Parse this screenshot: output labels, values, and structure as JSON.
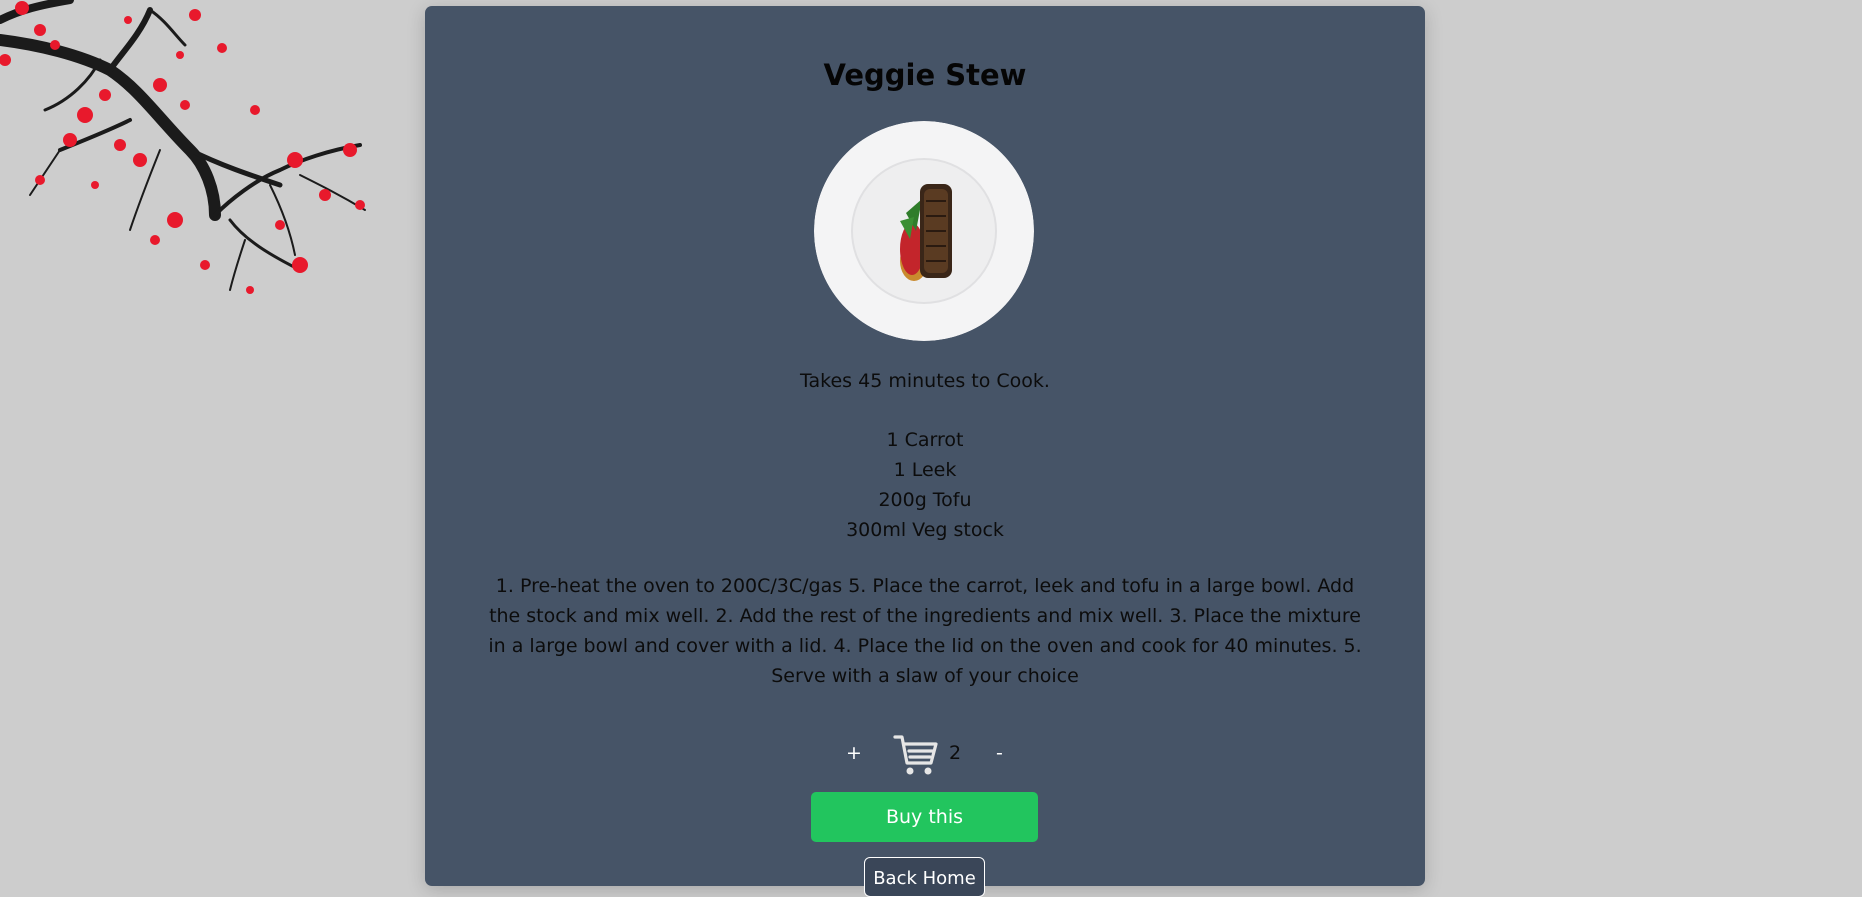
{
  "recipe": {
    "title": "Veggie Stew",
    "time_text": "Takes 45 minutes to Cook.",
    "ingredients": [
      "1 Carrot",
      "1 Leek",
      "200g Tofu",
      "300ml Veg stock"
    ],
    "instructions": "1. Pre-heat the oven to 200C/3C/gas 5. Place the carrot, leek and tofu in a large bowl. Add the stock and mix well. 2. Add the rest of the ingredients and mix well. 3. Place the mixture in a large bowl and cover with a lid. 4. Place the lid on the oven and cook for 40 minutes. 5. Serve with a slaw of your choice"
  },
  "cart": {
    "plus_label": "+",
    "minus_label": "-",
    "quantity": "2",
    "icon": "shopping-cart-icon"
  },
  "actions": {
    "buy_label": "Buy this",
    "back_label": "Back Home"
  },
  "colors": {
    "page_background": "#cdcdcd",
    "card_background": "#465467",
    "buy_button": "#22c55e",
    "blossom": "#e8192c"
  },
  "decor": {
    "blossom_icon": "cherry-blossom-branch-icon",
    "dish_image": "dish-photo"
  }
}
